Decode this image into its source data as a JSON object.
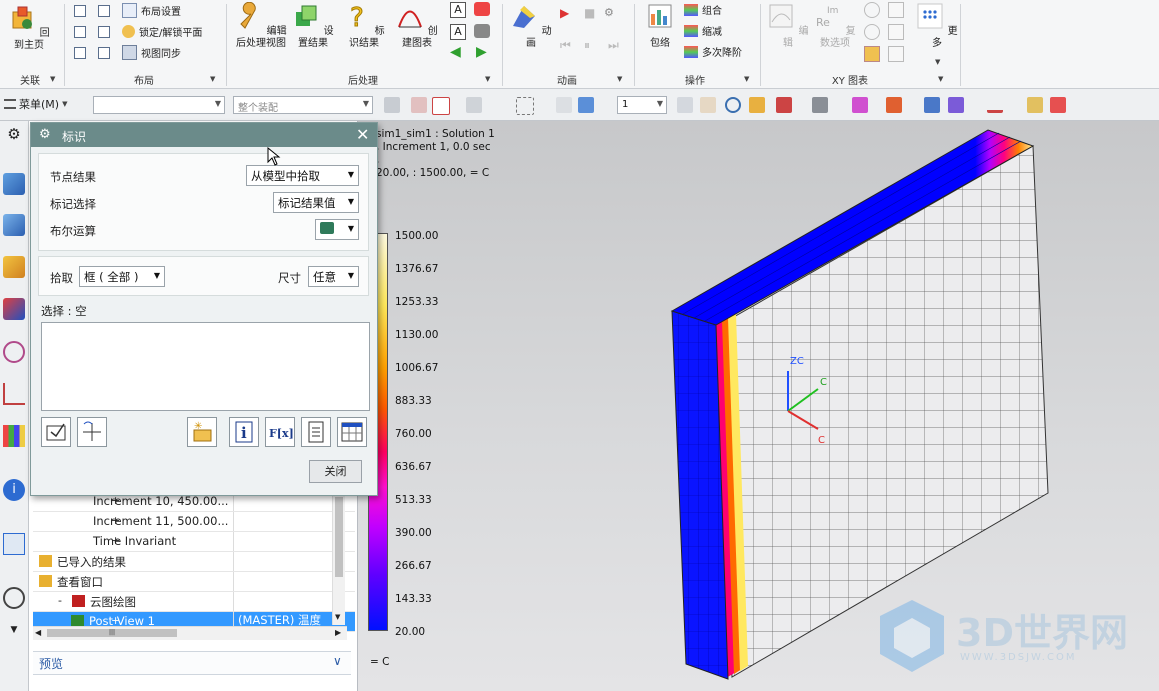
{
  "ribbon": {
    "groups": [
      {
        "label": "关联"
      },
      {
        "label": "布局"
      },
      {
        "label": "后处理"
      },
      {
        "label": "动画"
      },
      {
        "label": "操作"
      },
      {
        "label": "XY 图表"
      }
    ],
    "return_home": "回到主页",
    "layout_items": [
      "布局设置",
      "锁定/解锁平面",
      "视图同步"
    ],
    "postproc_buttons": [
      "编辑后处理视图",
      "设置结果",
      "标识结果",
      "创建图表"
    ],
    "animation_button": "动画",
    "op_button": "包络",
    "op_items": [
      "组合",
      "缩减",
      "多次降阶"
    ],
    "xy_buttons": [
      "编辑",
      "复数选项"
    ],
    "more_button": "更多"
  },
  "toolbar": {
    "menu_label": "菜单(M)",
    "filter_placeholder": "",
    "assembly_combo": "整个装配",
    "number_combo": "1"
  },
  "navigator": {
    "rows": [
      {
        "text": "Increment 10, 450.00...",
        "indent": 2,
        "expander": "+"
      },
      {
        "text": "Increment 11, 500.00...",
        "indent": 2,
        "expander": "+"
      },
      {
        "text": "Time Invariant",
        "indent": 2,
        "expander": "+"
      },
      {
        "text": "已导入的结果",
        "indent": 0,
        "expander": ""
      },
      {
        "text": "查看窗口",
        "indent": 0,
        "expander": ""
      },
      {
        "text": "云图绘图",
        "indent": 1,
        "expander": "-"
      },
      {
        "text": "Post View 1",
        "indent": 2,
        "expander": "+",
        "col2": "(MASTER) 温度"
      }
    ],
    "preview_label": "预览"
  },
  "dialog": {
    "title": "标识",
    "node_result_label": "节点结果",
    "node_result_value": "从模型中拾取",
    "mark_select_label": "标记选择",
    "mark_select_value": "标记结果值",
    "boolean_label": "布尔运算",
    "pick_label": "拾取",
    "pick_value": "框 ( 全部 )",
    "size_label": "尺寸",
    "size_value": "任意",
    "selection_label": "选择 : 空",
    "close_label": "关闭"
  },
  "viewport": {
    "info_line1": "sim1_sim1 : Solution 1",
    "info_line2": ", Increment 1, 0.0 sec",
    "info_line3": ",",
    "info_line4": "20.00, : 1500.00, = C",
    "legend_values": [
      "1500.00",
      "1376.67",
      "1253.33",
      "1130.00",
      "1006.67",
      "883.33",
      "760.00",
      "636.67",
      "513.33",
      "390.00",
      "266.67",
      "143.33",
      "20.00"
    ],
    "unit_label": "= C",
    "axis_labels": {
      "zc": "ZC",
      "yc": "C",
      "xc": "C"
    },
    "colors": {
      "legend_top": "#fff8d0",
      "legend_mid": "#ff1080",
      "legend_bottom": "#0000ff",
      "block_face": "#ececee"
    }
  },
  "watermark": {
    "brand": "3D世界网",
    "url": "WWW.3DSJW.COM"
  }
}
